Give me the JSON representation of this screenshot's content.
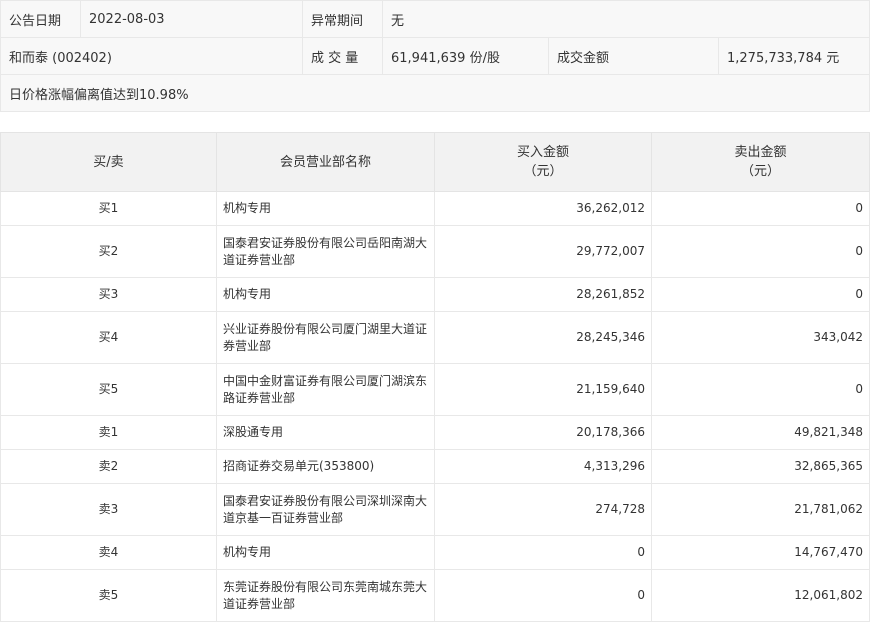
{
  "info": {
    "date_label": "公告日期",
    "date_value": "2022-08-03",
    "abnormal_label": "异常期间",
    "abnormal_value": "无",
    "stock": "和而泰 (002402)",
    "volume_label": "成 交 量",
    "volume_value": "61,941,639 份/股",
    "amount_label": "成交金额",
    "amount_value": "1,275,733,784 元",
    "reason": "日价格涨幅偏离值达到10.98%"
  },
  "table": {
    "headers": {
      "side": "买/卖",
      "member": "会员营业部名称",
      "buy_line1": "买入金额",
      "buy_line2": "（元）",
      "sell_line1": "卖出金额",
      "sell_line2": "（元）"
    },
    "rows": [
      {
        "side": "买1",
        "name": "机构专用",
        "buy": "36,262,012",
        "sell": "0"
      },
      {
        "side": "买2",
        "name": "国泰君安证券股份有限公司岳阳南湖大道证券营业部",
        "buy": "29,772,007",
        "sell": "0"
      },
      {
        "side": "买3",
        "name": "机构专用",
        "buy": "28,261,852",
        "sell": "0"
      },
      {
        "side": "买4",
        "name": "兴业证券股份有限公司厦门湖里大道证券营业部",
        "buy": "28,245,346",
        "sell": "343,042"
      },
      {
        "side": "买5",
        "name": "中国中金财富证券有限公司厦门湖滨东路证券营业部",
        "buy": "21,159,640",
        "sell": "0"
      },
      {
        "side": "卖1",
        "name": "深股通专用",
        "buy": "20,178,366",
        "sell": "49,821,348"
      },
      {
        "side": "卖2",
        "name": "招商证券交易单元(353800)",
        "buy": "4,313,296",
        "sell": "32,865,365"
      },
      {
        "side": "卖3",
        "name": "国泰君安证券股份有限公司深圳深南大道京基一百证券营业部",
        "buy": "274,728",
        "sell": "21,781,062"
      },
      {
        "side": "卖4",
        "name": "机构专用",
        "buy": "0",
        "sell": "14,767,470"
      },
      {
        "side": "卖5",
        "name": "东莞证券股份有限公司东莞南城东莞大道证券营业部",
        "buy": "0",
        "sell": "12,061,802"
      }
    ]
  }
}
